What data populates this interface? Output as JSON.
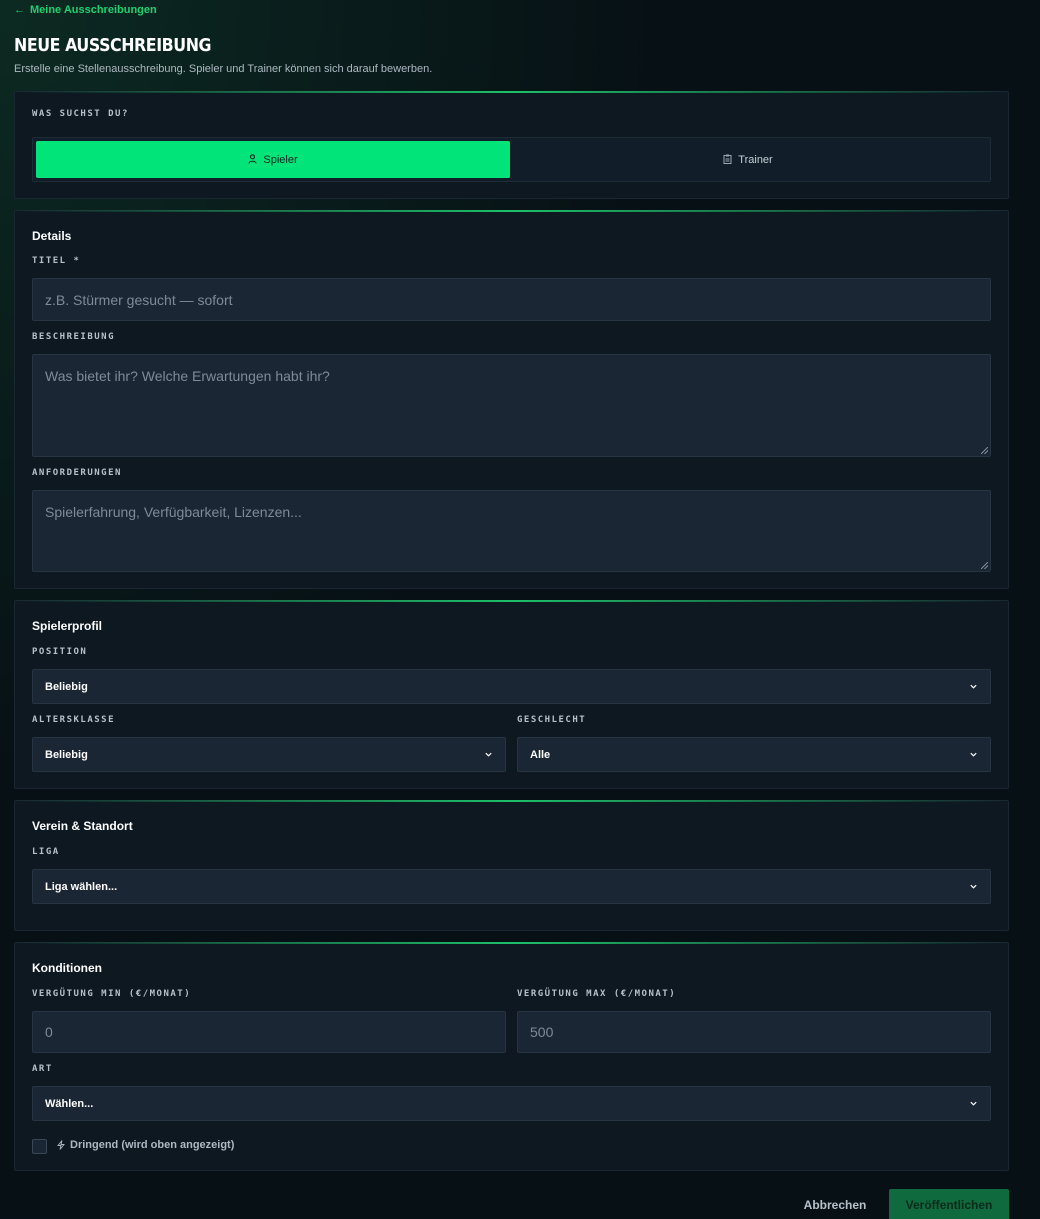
{
  "nav": {
    "back_label": "Meine Ausschreibungen"
  },
  "header": {
    "title": "NEUE AUSSCHREIBUNG",
    "subtitle": "Erstelle eine Stellenausschreibung. Spieler und Trainer können sich darauf bewerben."
  },
  "type_section": {
    "label": "WAS SUCHST DU?",
    "options": [
      {
        "label": "Spieler",
        "icon": "person-icon",
        "selected": true
      },
      {
        "label": "Trainer",
        "icon": "clipboard-icon",
        "selected": false
      }
    ]
  },
  "details": {
    "title": "Details",
    "titel_label": "TITEL *",
    "titel_placeholder": "z.B. Stürmer gesucht — sofort",
    "beschreibung_label": "BESCHREIBUNG",
    "beschreibung_placeholder": "Was bietet ihr? Welche Erwartungen habt ihr?",
    "anforderungen_label": "ANFORDERUNGEN",
    "anforderungen_placeholder": "Spielerfahrung, Verfügbarkeit, Lizenzen..."
  },
  "profile": {
    "title": "Spielerprofil",
    "position_label": "POSITION",
    "position_value": "Beliebig",
    "altersklasse_label": "ALTERSKLASSE",
    "altersklasse_value": "Beliebig",
    "geschlecht_label": "GESCHLECHT",
    "geschlecht_value": "Alle"
  },
  "club": {
    "title": "Verein & Standort",
    "liga_label": "LIGA",
    "liga_value": "Liga wählen..."
  },
  "conditions": {
    "title": "Konditionen",
    "min_label": "VERGÜTUNG MIN (€/MONAT)",
    "min_placeholder": "0",
    "max_label": "VERGÜTUNG MAX (€/MONAT)",
    "max_placeholder": "500",
    "art_label": "ART",
    "art_value": "Wählen...",
    "urgent_label": "Dringend (wird oben angezeigt)",
    "urgent_checked": false
  },
  "actions": {
    "cancel_label": "Abbrechen",
    "publish_label": "Veröffentlichen"
  },
  "colors": {
    "accent": "#00e47a",
    "background": "#071015",
    "card": "#0d1821",
    "field": "#1a2633"
  }
}
